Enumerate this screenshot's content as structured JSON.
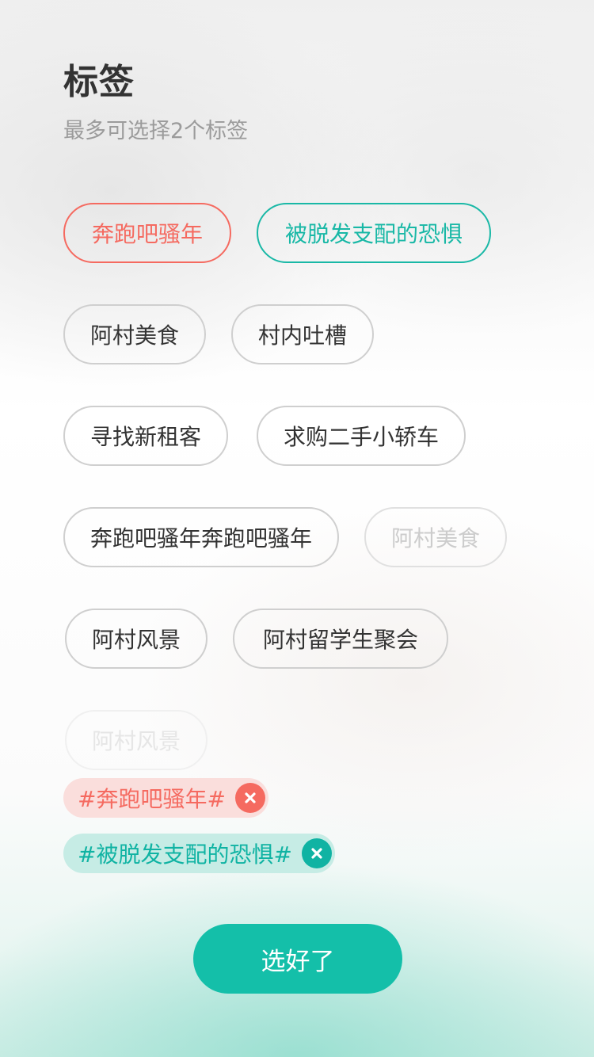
{
  "header": {
    "title": "标签",
    "subtitle": "最多可选择2个标签"
  },
  "tags": [
    {
      "label": "奔跑吧骚年",
      "state": "selected-red"
    },
    {
      "label": "被脱发支配的恐惧",
      "state": "selected-teal"
    },
    {
      "label": "阿村美食",
      "state": "normal"
    },
    {
      "label": "村内吐槽",
      "state": "normal"
    },
    {
      "label": "寻找新租客",
      "state": "normal"
    },
    {
      "label": "求购二手小轿车",
      "state": "normal"
    },
    {
      "label": "奔跑吧骚年奔跑吧骚年",
      "state": "normal"
    },
    {
      "label": "阿村美食",
      "state": "disabled"
    },
    {
      "label": "阿村风景",
      "state": "normal"
    },
    {
      "label": "阿村留学生聚会",
      "state": "normal"
    },
    {
      "label": "阿村风景",
      "state": "disabled"
    }
  ],
  "selected": [
    {
      "label": "#奔跑吧骚年#",
      "color": "#f56a60",
      "icon": "close-icon"
    },
    {
      "label": "#被脱发支配的恐惧#",
      "color": "#10b3a3",
      "icon": "close-icon"
    }
  ],
  "confirm_label": "选好了",
  "colors": {
    "accent_teal": "#14bfa9",
    "accent_red": "#f56a60"
  }
}
